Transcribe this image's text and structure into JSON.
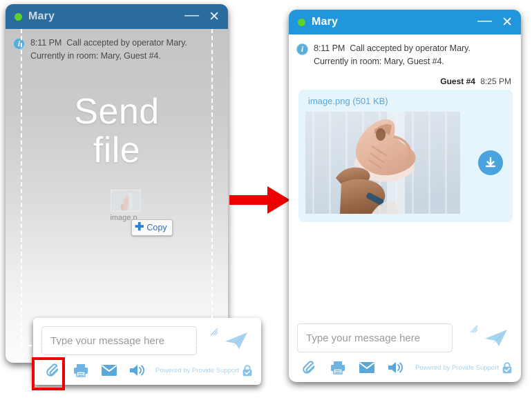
{
  "colors": {
    "left_titlebar": "#2a6c9e",
    "right_titlebar": "#2196dd",
    "status_dot": "#5fd12a",
    "accent_blue": "#5ba7d8",
    "bubble_bg": "#e6f4fb",
    "arrow_red": "#ef0000",
    "highlight_red": "#ef0000",
    "download_btn": "#4aa3dd"
  },
  "left_panel": {
    "titlebar": {
      "operator_name": "Mary",
      "status": "online",
      "minimize_label": "—",
      "close_label": "✕"
    },
    "system_message": {
      "icon": "info-icon",
      "time": "8:11 PM",
      "line1": "Call accepted by operator Mary.",
      "line2": "Currently in room: Mary, Guest #4."
    },
    "dropzone": {
      "title_line1": "Send",
      "title_line2": "file"
    },
    "drag_ghost": {
      "file_label": "image.p",
      "badge_plus": "✚",
      "badge_label": "Copy"
    },
    "composer": {
      "input_placeholder": "Type your message here",
      "input_value": "",
      "send_icon": "send-plane-icon",
      "tools": [
        {
          "name": "attach-file-icon",
          "label": "Attach file",
          "highlighted": true
        },
        {
          "name": "print-icon",
          "label": "Print transcript",
          "highlighted": false
        },
        {
          "name": "email-icon",
          "label": "Email transcript",
          "highlighted": false
        },
        {
          "name": "sound-icon",
          "label": "Sound",
          "highlighted": false
        }
      ],
      "powered_by": "Powered by Provide Support",
      "powered_icon": "lock-check-icon"
    }
  },
  "arrow": {
    "name": "flow-arrow-right",
    "direction": "right"
  },
  "right_panel": {
    "titlebar": {
      "operator_name": "Mary",
      "status": "online",
      "minimize_label": "—",
      "close_label": "✕"
    },
    "system_message": {
      "icon": "info-icon",
      "time": "8:11 PM",
      "line1": "Call accepted by operator Mary.",
      "line2": "Currently in room: Mary, Guest #4."
    },
    "message": {
      "sender": "Guest #4",
      "time": "8:25 PM",
      "file_name": "image.png",
      "file_size": "501 KB",
      "file_link_text": "image.png (501 KB)",
      "preview_alt": "hand holding a pink sneaker",
      "download_icon": "download-icon"
    },
    "composer": {
      "input_placeholder": "Type your message here",
      "input_value": "",
      "send_icon": "send-plane-icon",
      "tools": [
        {
          "name": "attach-file-icon",
          "label": "Attach file",
          "highlighted": false
        },
        {
          "name": "print-icon",
          "label": "Print transcript",
          "highlighted": false
        },
        {
          "name": "email-icon",
          "label": "Email transcript",
          "highlighted": false
        },
        {
          "name": "sound-icon",
          "label": "Sound",
          "highlighted": false
        }
      ],
      "powered_by": "Powered by Provide Support",
      "powered_icon": "lock-check-icon"
    }
  }
}
